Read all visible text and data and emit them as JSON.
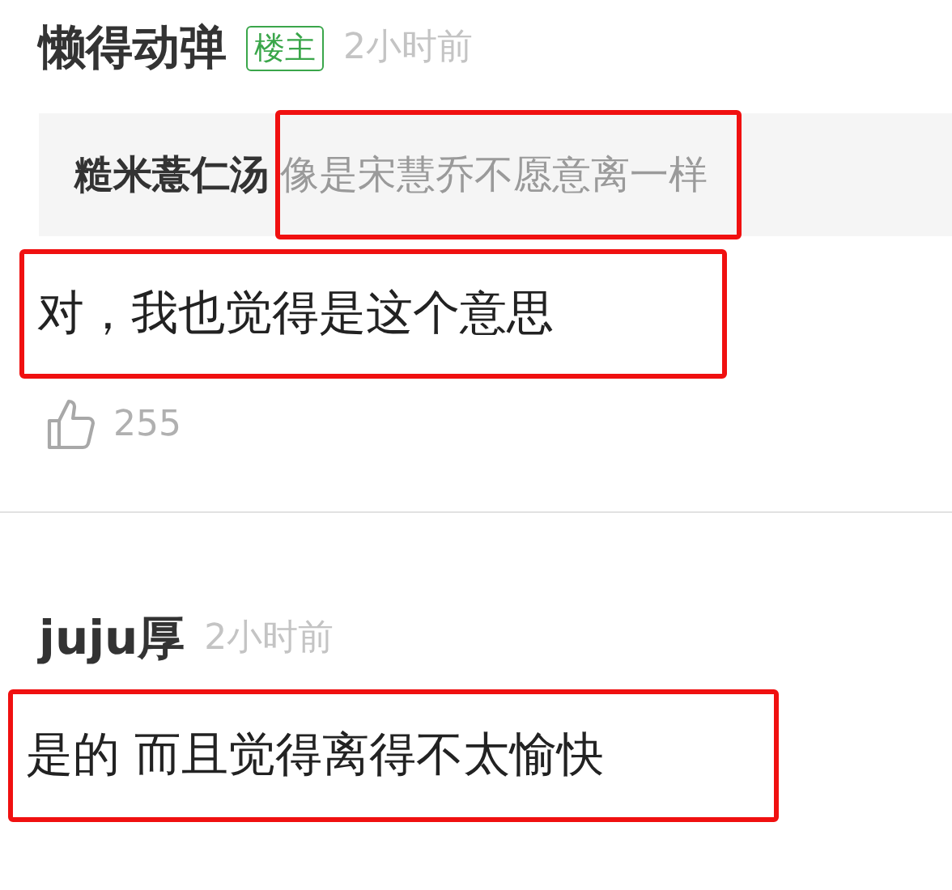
{
  "comments": [
    {
      "author": "懒得动弹",
      "badge": "楼主",
      "time": "2小时前",
      "quote": {
        "author": "糙米薏仁汤",
        "text": "像是宋慧乔不愿意离一样",
        "highlighted": true
      },
      "text": "对，我也觉得是这个意思",
      "highlighted": true,
      "likes": "255"
    },
    {
      "author": "juju厚",
      "time": "2小时前",
      "text": "是的 而且觉得离得不太愉快",
      "highlighted": true
    }
  ]
}
